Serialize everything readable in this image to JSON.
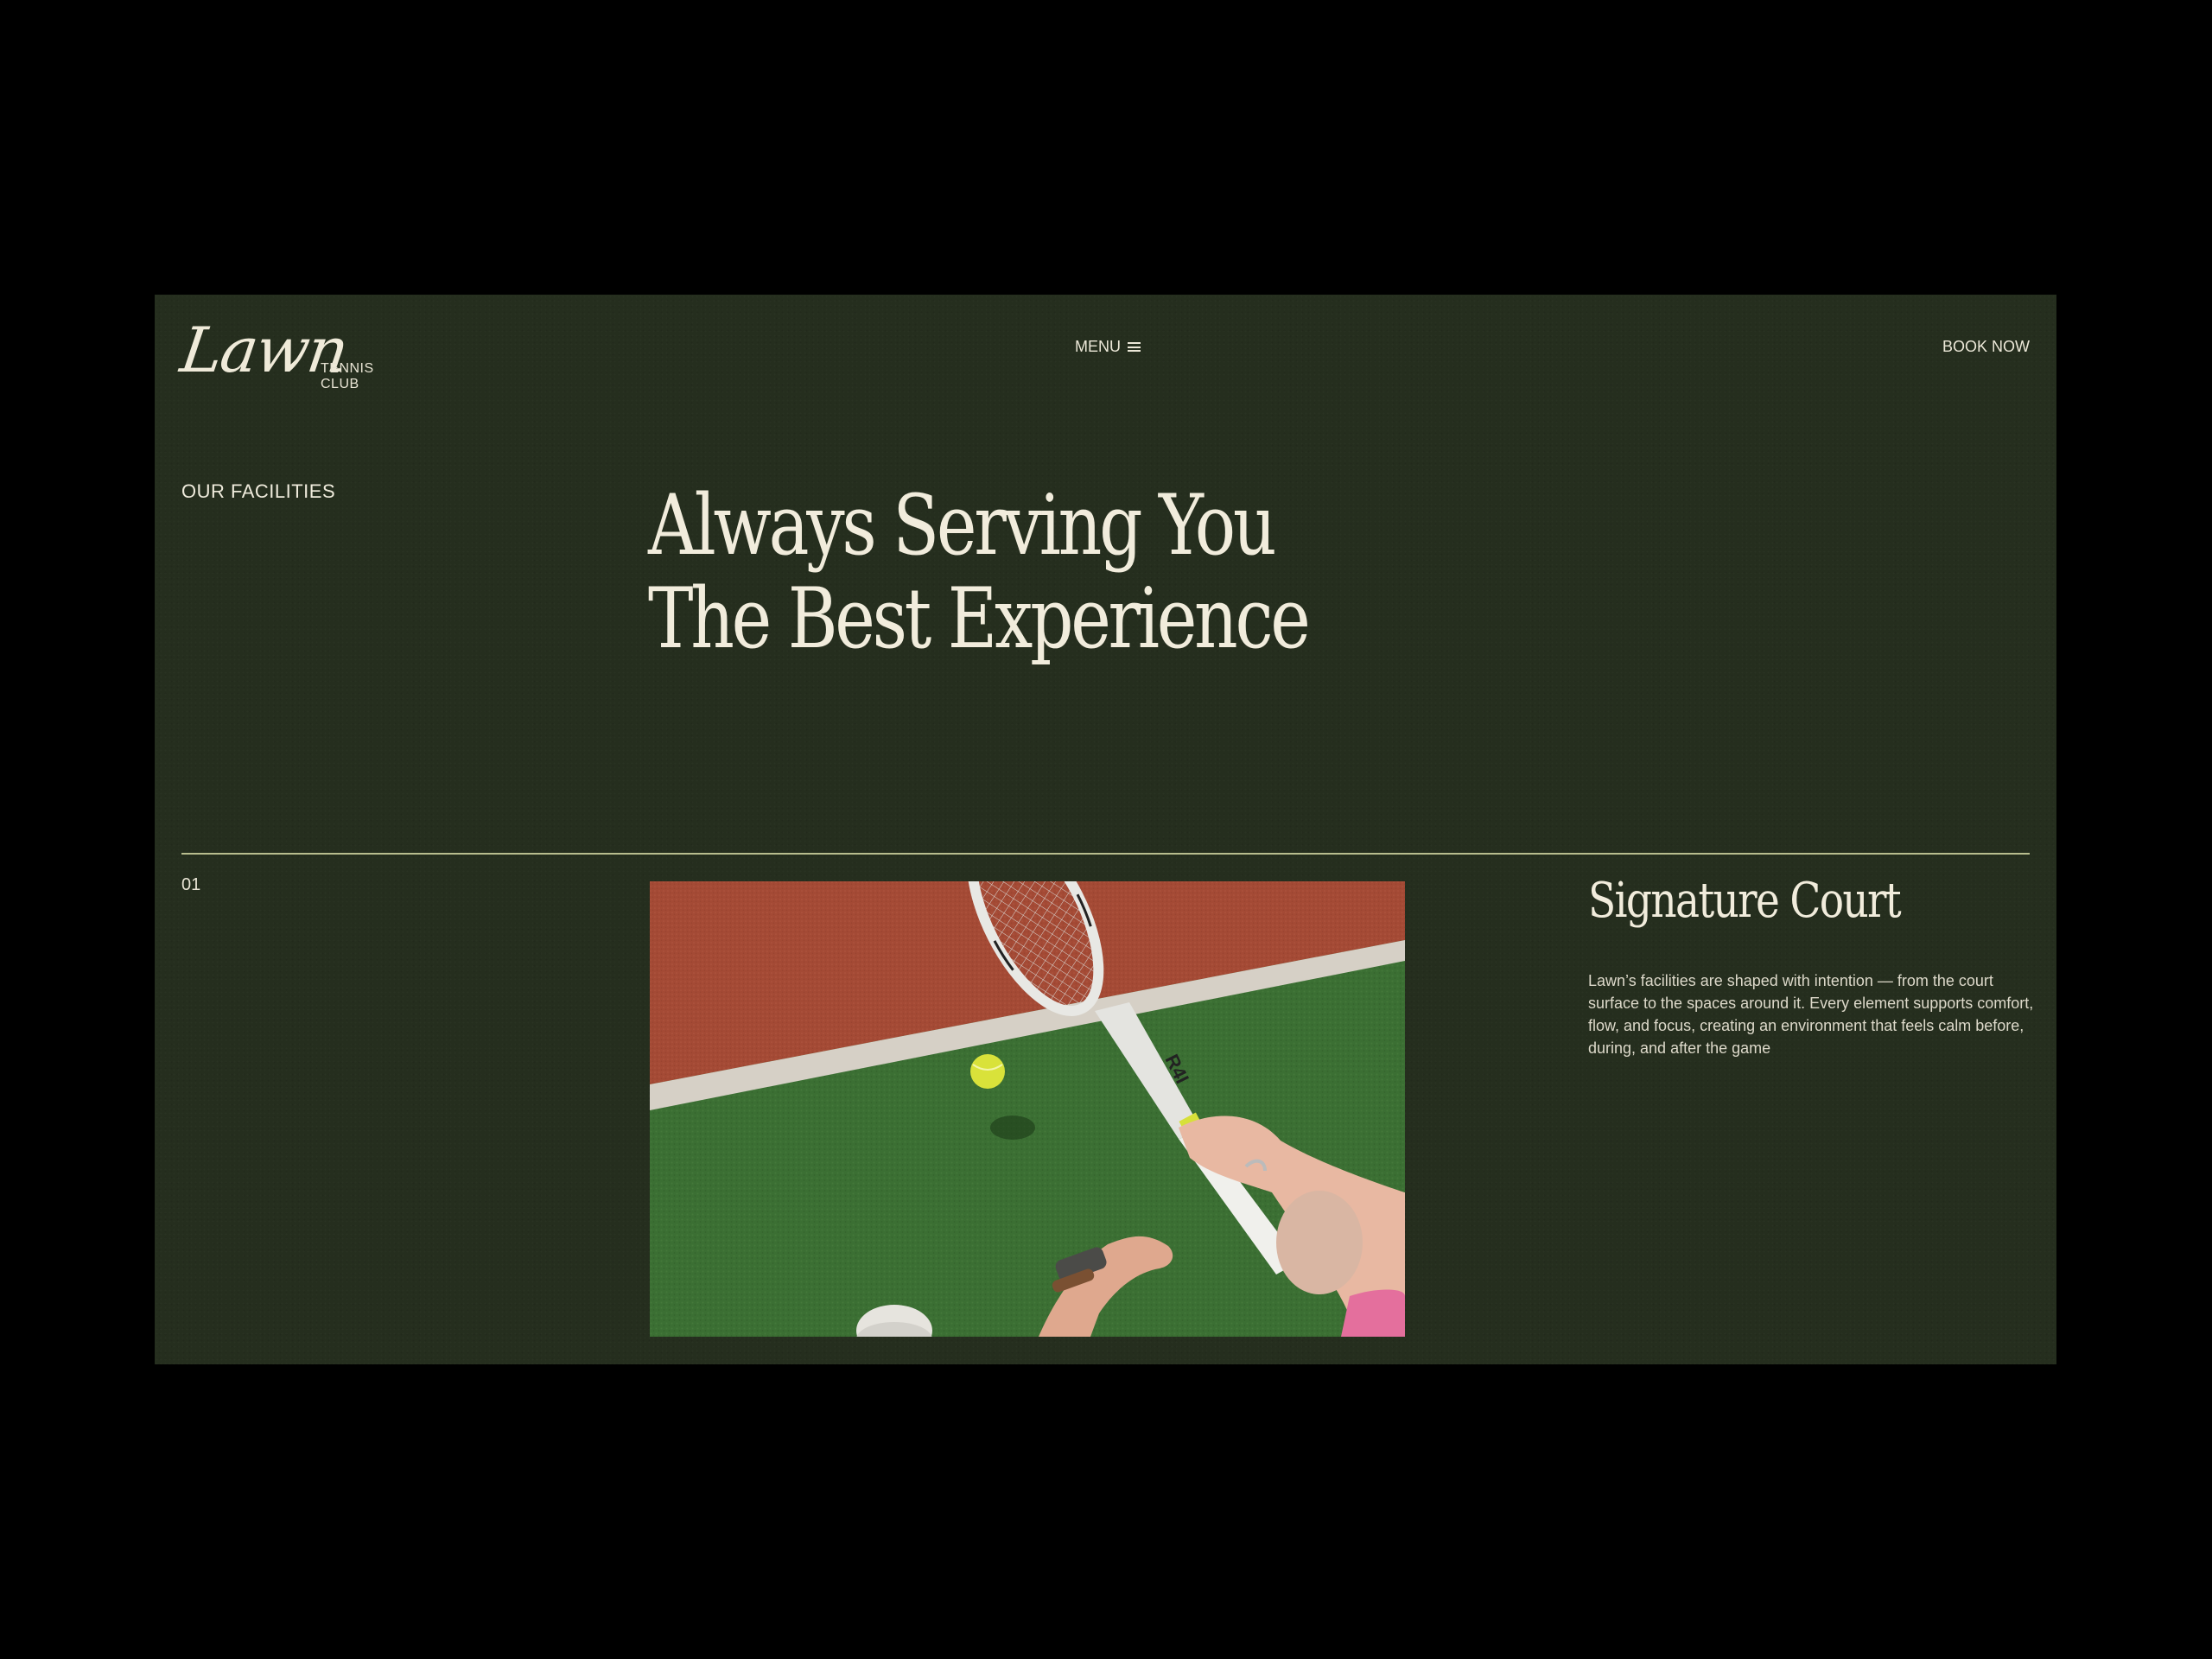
{
  "header": {
    "logo_script": "Lawn",
    "logo_line1": "TENNIS",
    "logo_line2": "CLUB",
    "menu_label": "MENU",
    "book_label": "BOOK NOW"
  },
  "hero": {
    "section_label": "OUR FACILITIES",
    "headline_line1": "Always Serving You",
    "headline_line2": "The Best Experience"
  },
  "facility": {
    "number": "01",
    "title": "Signature Court",
    "description": "Lawn’s facilities are shaped with intention — from the court surface to the spaces around it. Every element supports comfort, flow, and focus, creating an environment that feels calm before, during, and after the game",
    "racket_text": "R4I"
  },
  "colors": {
    "page_background": "#000000",
    "panel_background": "#252e1e",
    "text_cream": "#f1ecdc",
    "divider": "#b8bd8e",
    "clay": "#a44a35",
    "turf": "#3a6e32",
    "ball": "#d9e23a"
  },
  "icons": {
    "menu": "hamburger-icon"
  }
}
